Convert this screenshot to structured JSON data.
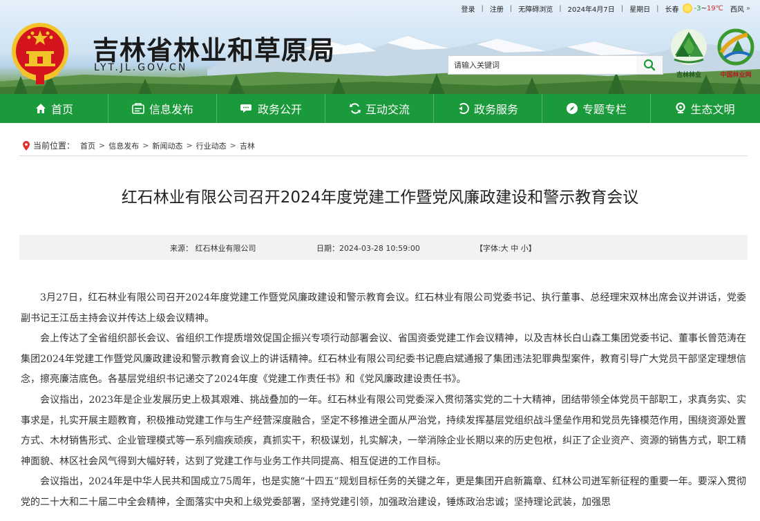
{
  "topbar": {
    "login": "登录",
    "register": "注册",
    "accessible": "无障碍浏览",
    "date": "2024年4月7日",
    "weekday": "星期日",
    "city": "长春",
    "temp_low": "-3",
    "temp_sep": "~",
    "temp_high": "19℃",
    "wind": "西风",
    "more": "»"
  },
  "header": {
    "title": "吉林省林业和草原局",
    "domain": "LYT.JL.GOV.CN"
  },
  "search": {
    "placeholder": "请输入关键词"
  },
  "logos": {
    "jilin_forest": "吉林林业",
    "china_forest": "中国林业网"
  },
  "nav": {
    "items": [
      {
        "label": "首页",
        "icon": "home-icon"
      },
      {
        "label": "信息发布",
        "icon": "info-icon"
      },
      {
        "label": "政务公开",
        "icon": "chat-icon"
      },
      {
        "label": "互动交流",
        "icon": "refresh-icon"
      },
      {
        "label": "政务服务",
        "icon": "service-icon"
      },
      {
        "label": "专题专栏",
        "icon": "compass-icon"
      },
      {
        "label": "生态文明",
        "icon": "pin-icon"
      }
    ]
  },
  "breadcrumb": {
    "label": "当前位置：",
    "items": [
      "首页",
      "信息发布",
      "新闻动态",
      "行业动态",
      "吉林"
    ],
    "separator": ">"
  },
  "article": {
    "title": "红石林业有限公司召开2024年度党建工作暨党风廉政建设和警示教育会议",
    "source": "来源：  红石林业有限公司",
    "date": "日期：2024-03-28 10:59:00",
    "fontsize": "【字体:大 中 小】",
    "paragraphs": [
      "3月27日，红石林业有限公司召开2024年度党建工作暨党风廉政建设和警示教育会议。红石林业有限公司党委书记、执行董事、总经理宋双林出席会议并讲话，党委副书记王江岳主持会议并传达上级会议精神。",
      "会上传达了全省组织部长会议、省组织工作提质增效促国企振兴专项行动部署会议、省国资委党建工作会议精神，以及吉林长白山森工集团党委书记、董事长曾范涛在集团2024年党建工作暨党风廉政建设和警示教育会议上的讲话精神。红石林业有限公司纪委书记鹿启斌通报了集团违法犯罪典型案件，教育引导广大党员干部坚定理想信念，擦亮廉洁底色。各基层党组织书记递交了2024年度《党建工作责任书》和《党风廉政建设责任书》。",
      "会议指出，2023年是企业发展历史上极其艰难、挑战叠加的一年。红石林业有限公司党委深入贯彻落实党的二十大精神，团结带领全体党员干部职工，求真务实、实事求是，扎实开展主题教育，积极推动党建工作与生产经营深度融合，坚定不移推进全面从严治党，持续发挥基层党组织战斗堡垒作用和党员先锋模范作用，围绕资源处置方式、木材销售形式、企业管理模式等一系列痼疾顽疾，真抓实干，积极谋划，扎实解决，一举消除企业长期以来的历史包袱，纠正了企业资产、资源的销售方式，职工精神面貌、林区社会风气得到大幅好转，达到了党建工作与业务工作共同提高、相互促进的工作目标。",
      "会议指出，2024年是中华人民共和国成立75周年，也是实施“十四五”规划目标任务的关键之年，更是集团开启新篇章、红林公司迸军新征程的重要一年。要深入贯彻党的二十大和二十届二中全会精神，全面落实中央和上级党委部署，坚持党建引领，加强政治建设，锤炼政治忠诚；坚持理论武装，加强思"
    ]
  },
  "colors": {
    "nav_green": "#1a9a3a",
    "emblem_red": "#d4141d",
    "emblem_gold": "#f3c42a",
    "breadcrumb_pin": "#e0302a",
    "meta_bg": "#f2f2f2"
  }
}
